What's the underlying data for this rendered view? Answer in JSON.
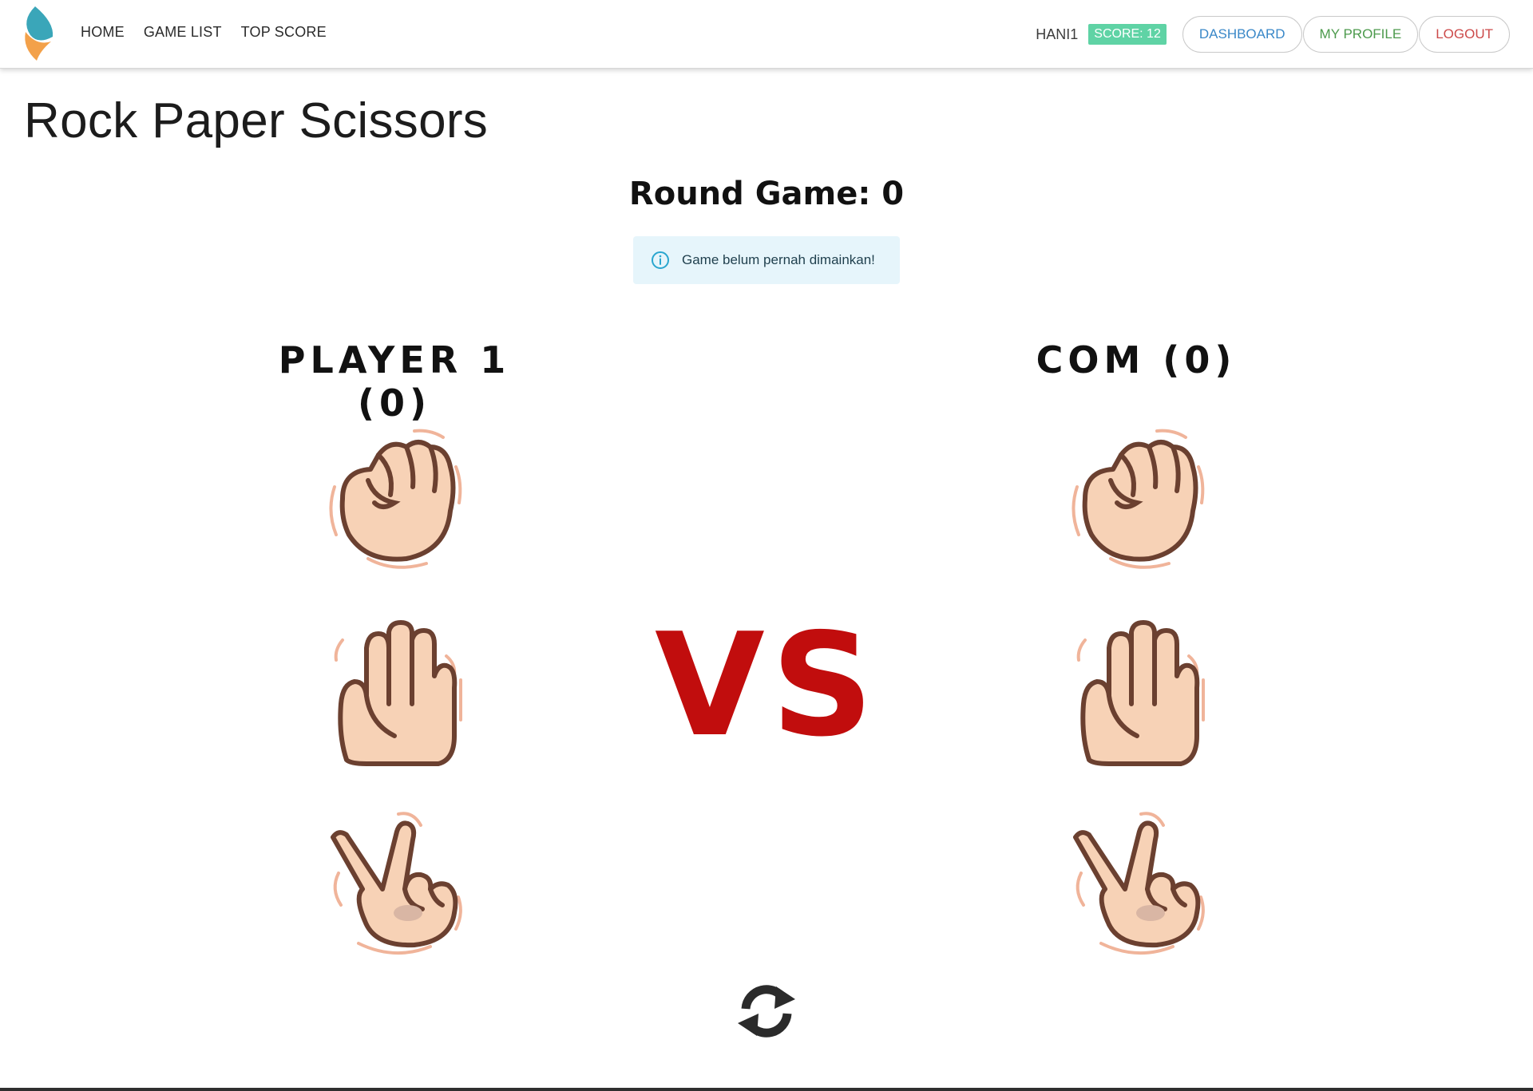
{
  "navbar": {
    "links": [
      "HOME",
      "GAME LIST",
      "TOP SCORE"
    ],
    "username": "HANI1",
    "score_badge": "SCORE: 12",
    "buttons": {
      "dashboard": "DASHBOARD",
      "profile": "MY PROFILE",
      "logout": "LOGOUT"
    }
  },
  "page": {
    "title": "Rock Paper Scissors",
    "round_label": "Round Game: 0",
    "alert": "Game belum pernah dimainkan!"
  },
  "players": {
    "player1": "PLAYER 1 (0)",
    "com": "COM (0)"
  },
  "vs_text": "VS",
  "choices": [
    "rock",
    "paper",
    "scissors"
  ],
  "colors": {
    "score_badge": "#5fd3a5",
    "vs": "#c10d0d",
    "alert_bg": "#e6f5fb",
    "dashboard": "#3a88c8",
    "profile": "#4c9a4c",
    "logout": "#cc4a4a"
  }
}
